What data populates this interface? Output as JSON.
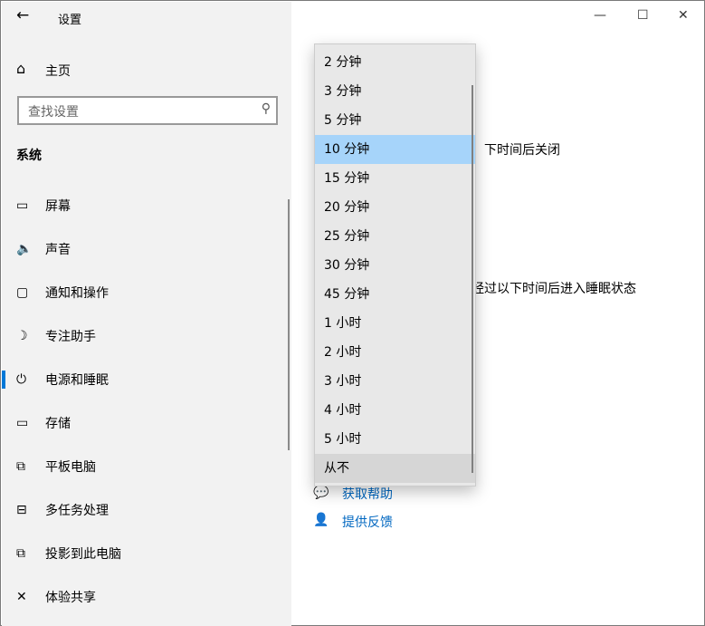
{
  "window": {
    "title": "设置",
    "minimize": "—",
    "maximize": "☐",
    "close": "✕",
    "back": "←"
  },
  "sidebar": {
    "home": "主页",
    "search_placeholder": "查找设置",
    "section": "系统",
    "items": [
      {
        "label": "屏幕",
        "icon": "▭"
      },
      {
        "label": "声音",
        "icon": "🔈"
      },
      {
        "label": "通知和操作",
        "icon": "▢"
      },
      {
        "label": "专注助手",
        "icon": "☽"
      },
      {
        "label": "电源和睡眠",
        "icon": "⏻"
      },
      {
        "label": "存储",
        "icon": "▭"
      },
      {
        "label": "平板电脑",
        "icon": "⧉"
      },
      {
        "label": "多任务处理",
        "icon": "⊟"
      },
      {
        "label": "投影到此电脑",
        "icon": "⧉"
      },
      {
        "label": "体验共享",
        "icon": "✕"
      }
    ]
  },
  "main": {
    "screen_text": "、下时间后关闭",
    "sleep_text": "经过以下时间后进入睡眠状态",
    "get_help": "获取帮助",
    "feedback": "提供反馈"
  },
  "dropdown": {
    "selected": "10 分钟",
    "options": [
      "2 分钟",
      "3 分钟",
      "5 分钟",
      "10 分钟",
      "15 分钟",
      "20 分钟",
      "25 分钟",
      "30 分钟",
      "45 分钟",
      "1 小时",
      "2 小时",
      "3 小时",
      "4 小时",
      "5 小时",
      "从不"
    ]
  },
  "colors": {
    "accent": "#0078d7",
    "highlight": "#a6d4fa",
    "link": "#0067c0"
  }
}
